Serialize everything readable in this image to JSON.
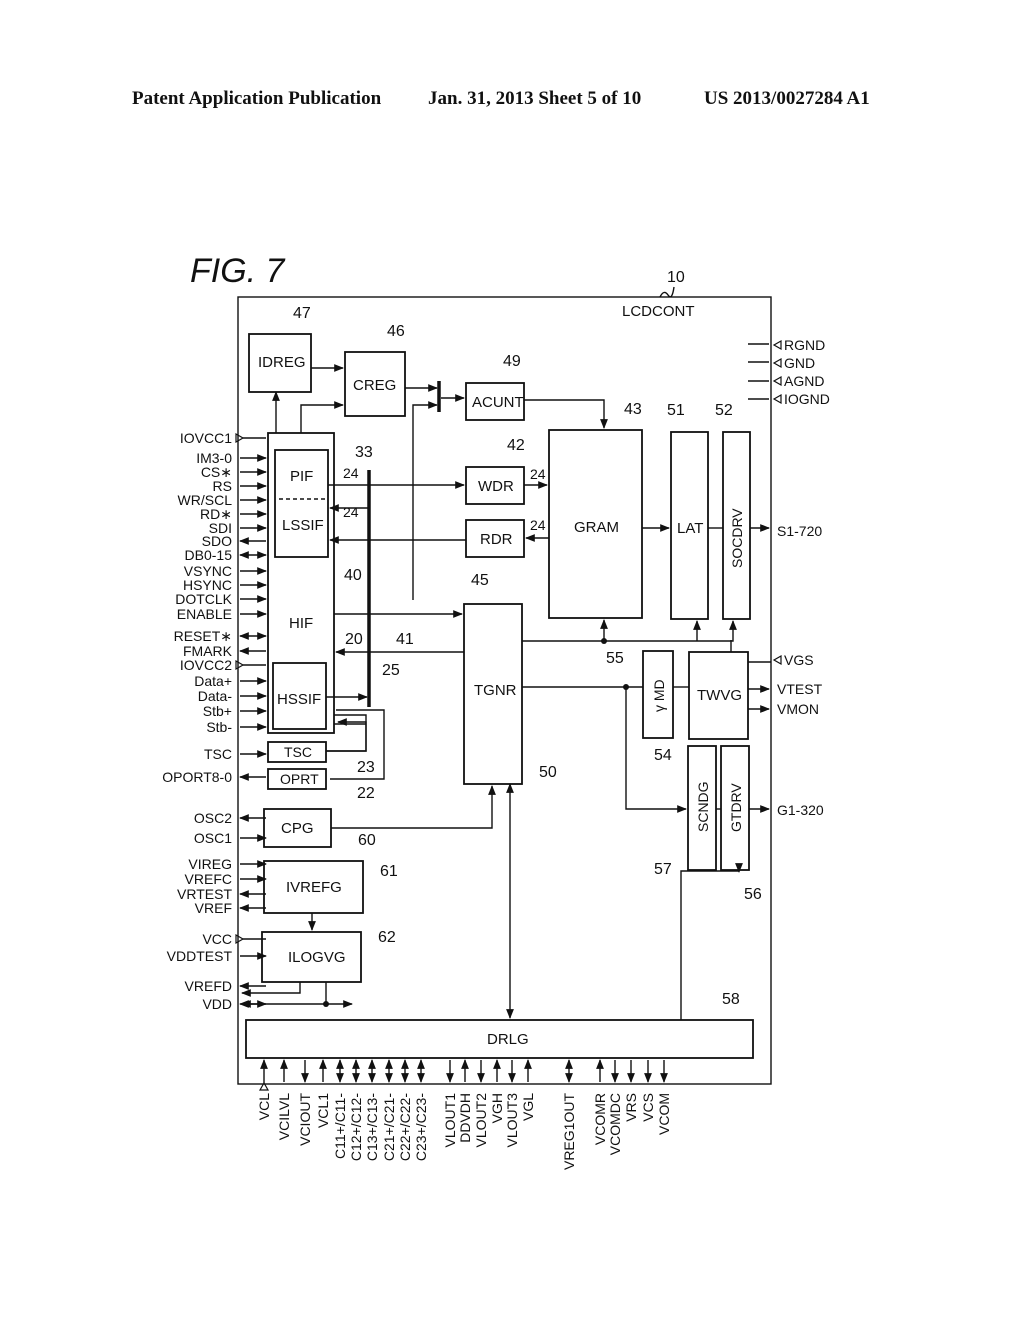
{
  "header": {
    "publication": "Patent Application Publication",
    "date_sheet": "Jan. 31, 2013   Sheet 5 of 10",
    "patent_number": "US 2013/0027284 A1"
  },
  "figure": {
    "title": "FIG.  7",
    "chip_ref": "10",
    "chip_name": "LCDCONT"
  },
  "blocks": {
    "idreg": {
      "name": "IDREG",
      "ref": "47"
    },
    "creg": {
      "name": "CREG",
      "ref": "46"
    },
    "acunt": {
      "name": "ACUNT",
      "ref": "49"
    },
    "wdr": {
      "name": "WDR",
      "ref": "42"
    },
    "rdr": {
      "name": "RDR",
      "ref": "45"
    },
    "gram": {
      "name": "GRAM",
      "ref": "43"
    },
    "lat": {
      "name": "LAT",
      "ref": "51"
    },
    "socdrv": {
      "name": "SOCDRV",
      "ref": "52"
    },
    "pif": {
      "name": "PIF",
      "ref": "33"
    },
    "lssif": {
      "name": "LSSIF",
      "ref": "40"
    },
    "hif": {
      "name": "HIF",
      "ref": "20"
    },
    "bus": {
      "ref": "41",
      "width_top": "24",
      "width_bottom": "24",
      "wdr_width": "24",
      "rdr_width": "24"
    },
    "hssif": {
      "name": "HSSIF",
      "ref": "25"
    },
    "tsc": {
      "name": "TSC",
      "ref": "23"
    },
    "oprt": {
      "name": "OPRT",
      "ref": "22"
    },
    "tgnr": {
      "name": "TGNR",
      "ref": "50"
    },
    "gmd": {
      "name": "γ MD",
      "ref": "55"
    },
    "twvg": {
      "name": "TWVG",
      "ref": "54"
    },
    "scndg": {
      "name": "SCNDG",
      "ref": "57"
    },
    "gtdrv": {
      "name": "GTDRV",
      "ref": "56"
    },
    "cpg": {
      "name": "CPG",
      "ref": "60"
    },
    "ivrefg": {
      "name": "IVREFG",
      "ref": "61"
    },
    "ilogvg": {
      "name": "ILOGVG",
      "ref": "62"
    },
    "drlg": {
      "name": "DRLG",
      "ref": "58"
    }
  },
  "left_pins": [
    "IOVCC1",
    "IM3-0",
    "CS∗",
    "RS",
    "WR/SCL",
    "RD∗",
    "SDI",
    "SDO",
    "DB0-15",
    "VSYNC",
    "HSYNC",
    "DOTCLK",
    "ENABLE",
    "RESET∗",
    "FMARK",
    "IOVCC2",
    "Data+",
    "Data-",
    "Stb+",
    "Stb-",
    "TSC",
    "OPORT8-0",
    "OSC2",
    "OSC1",
    "VIREG",
    "VREFC",
    "VRTEST",
    "VREF",
    "VCC",
    "VDDTEST",
    "VREFD",
    "VDD"
  ],
  "right_pins": [
    "RGND",
    "GND",
    "AGND",
    "IOGND",
    "S1-720",
    "VGS",
    "VTEST",
    "VMON",
    "G1-320"
  ],
  "bottom_pins": [
    "VCL",
    "VCILVL",
    "VCIOUT",
    "VCL1",
    "C11+/C11-",
    "C12+/C12-",
    "C13+/C13-",
    "C21+/C21-",
    "C22+/C22-",
    "C23+/C23-",
    "VLOUT1",
    "DDVDH",
    "VLOUT2",
    "VGH",
    "VLOUT3",
    "VGL",
    "VREG1OUT",
    "VCOMR",
    "VCOMDC",
    "VRS",
    "VCS",
    "VCOM"
  ]
}
